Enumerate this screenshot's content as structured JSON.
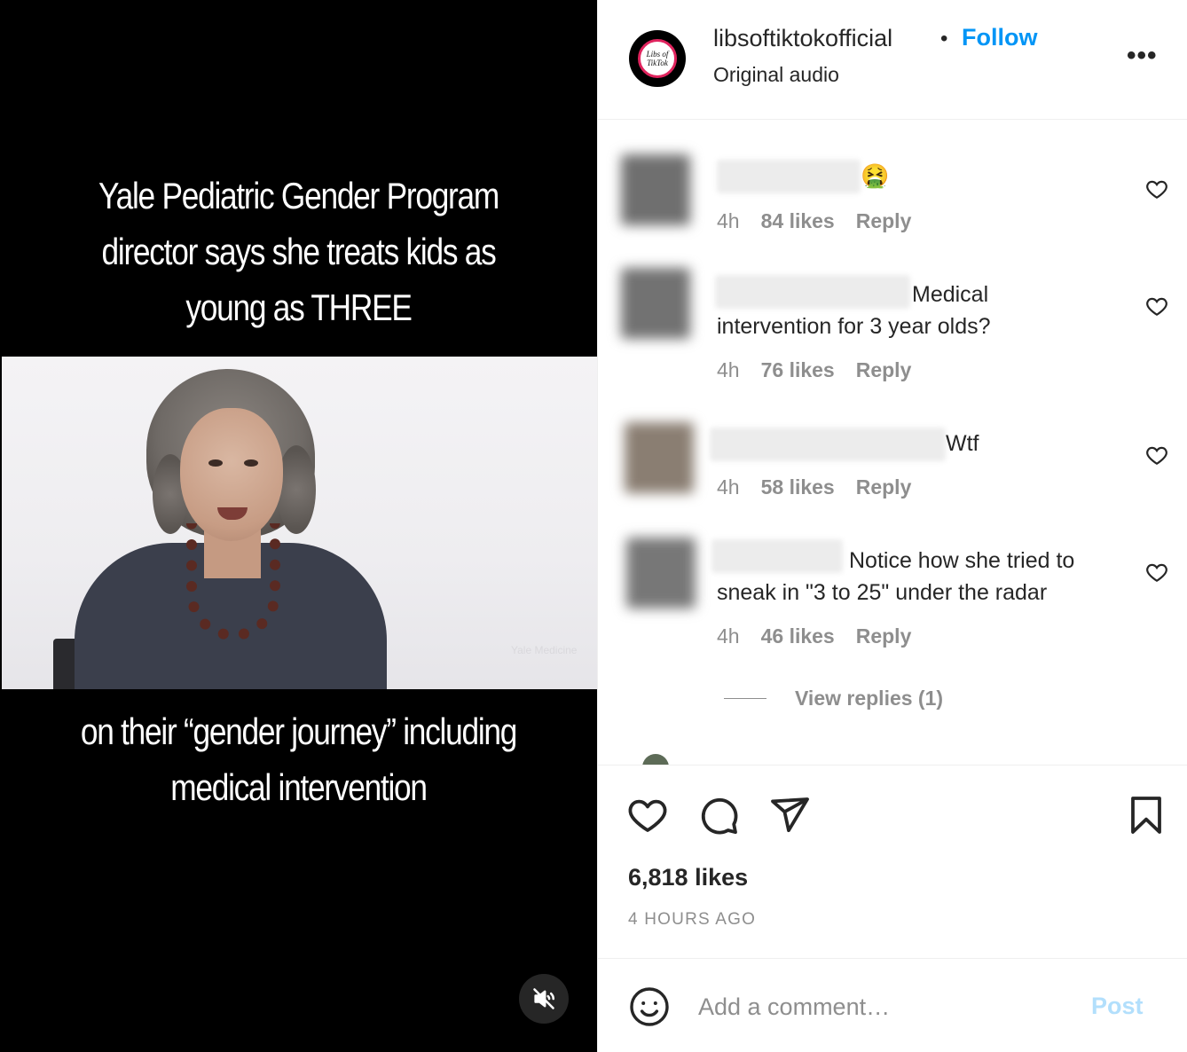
{
  "video": {
    "caption_top": [
      "Yale Pediatric Gender Program",
      "director says she treats kids as",
      "young as THREE"
    ],
    "caption_bottom": [
      "on their “gender journey” including",
      "medical intervention"
    ],
    "watermark": "Yale Medicine",
    "mute_icon": "muted-speaker-icon"
  },
  "header": {
    "username": "libsoftiktokofficial",
    "separator": "•",
    "follow_label": "Follow",
    "audio_label": "Original audio",
    "avatar_text": [
      "Libs of",
      "TikTok"
    ],
    "more_label": "•••"
  },
  "comments": [
    {
      "text": "🤮",
      "time": "4h",
      "likes": "84 likes",
      "reply": "Reply"
    },
    {
      "text_line1": "Medical",
      "text_line2": "intervention for 3 year olds?",
      "time": "4h",
      "likes": "76 likes",
      "reply": "Reply"
    },
    {
      "text": "Wtf",
      "time": "4h",
      "likes": "58 likes",
      "reply": "Reply"
    },
    {
      "text_line1": "Notice how she tried to",
      "text_line2": "sneak in \"3 to 25\" under the radar",
      "time": "4h",
      "likes": "46 likes",
      "reply": "Reply"
    }
  ],
  "view_replies": "View replies (1)",
  "post": {
    "likes": "6,818 likes",
    "time_ago": "4 HOURS AGO"
  },
  "composer": {
    "placeholder": "Add a comment…",
    "post_label": "Post"
  },
  "colors": {
    "accent": "#0095f6",
    "post_disabled": "#b2dffc",
    "muted_text": "#8e8e8e"
  }
}
